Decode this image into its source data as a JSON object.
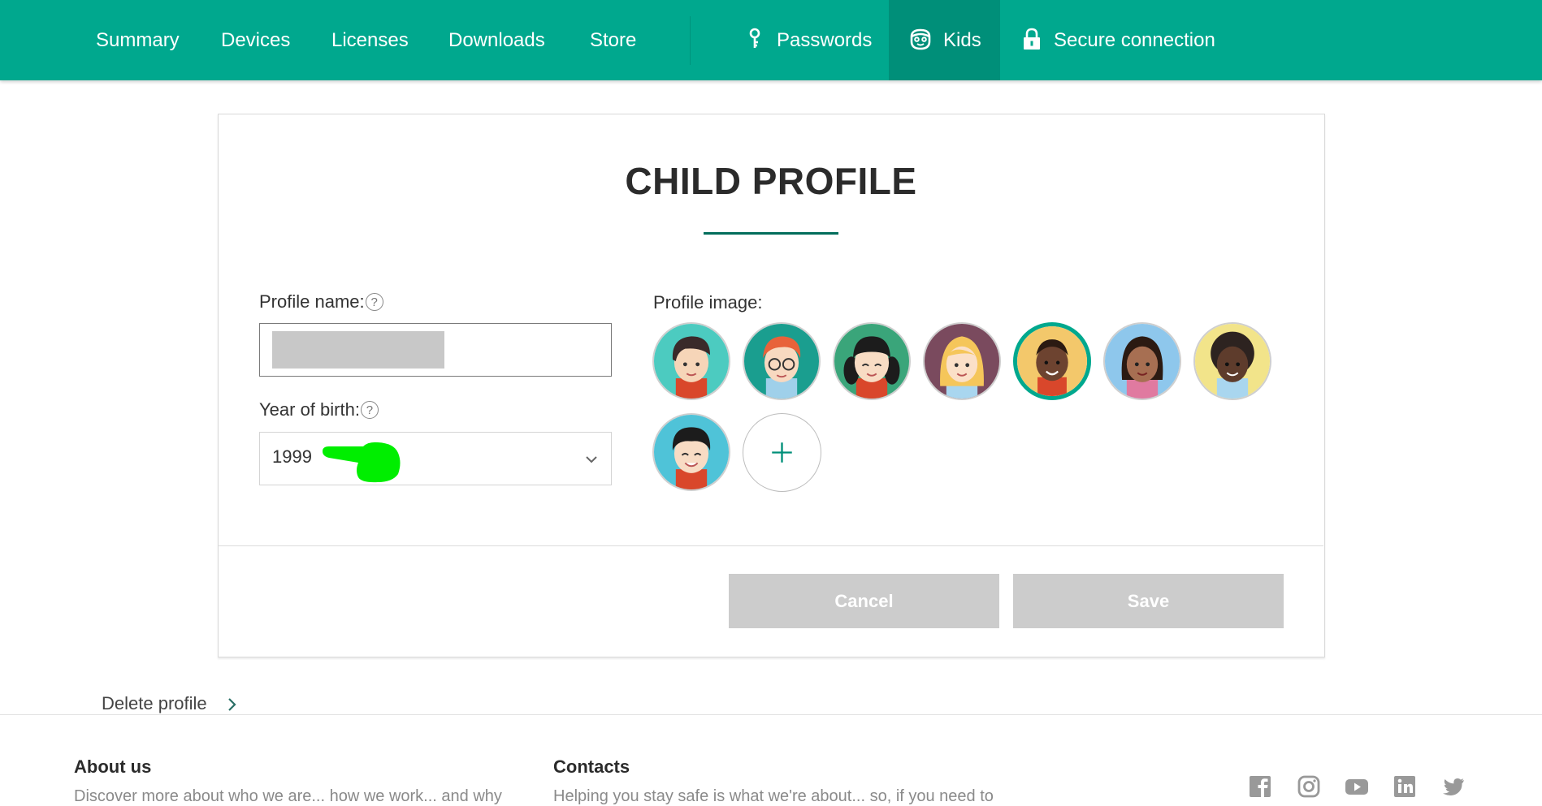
{
  "nav": {
    "items": [
      {
        "label": "Summary"
      },
      {
        "label": "Devices"
      },
      {
        "label": "Licenses"
      },
      {
        "label": "Downloads"
      },
      {
        "label": "Store"
      },
      {
        "label": "Passwords",
        "icon": "key-icon"
      },
      {
        "label": "Kids",
        "icon": "kid-face-icon",
        "active": true
      },
      {
        "label": "Secure connection",
        "icon": "lock-icon"
      }
    ]
  },
  "colors": {
    "brand": "#00a88e",
    "brand_active": "#008f79",
    "title_underline": "#006d5b",
    "button_disabled": "#cccccc"
  },
  "profile": {
    "title": "CHILD PROFILE",
    "name_label": "Profile name:",
    "name_value": "",
    "year_label": "Year of birth:",
    "year_value": "1999",
    "image_label": "Profile image:",
    "help_glyph": "?",
    "avatars": [
      {
        "name": "avatar-boy-dark-hair",
        "selected": false
      },
      {
        "name": "avatar-boy-glasses",
        "selected": false
      },
      {
        "name": "avatar-girl-pigtails",
        "selected": false
      },
      {
        "name": "avatar-girl-blonde",
        "selected": false
      },
      {
        "name": "avatar-boy-dark-skin",
        "selected": true
      },
      {
        "name": "avatar-girl-brown-hair",
        "selected": false
      },
      {
        "name": "avatar-girl-curly-hair",
        "selected": false
      },
      {
        "name": "avatar-boy-black-hair",
        "selected": false
      }
    ],
    "add_image_glyph": "+"
  },
  "actions": {
    "cancel": "Cancel",
    "save": "Save"
  },
  "delete_profile": "Delete profile",
  "footer": {
    "about_heading": "About us",
    "about_text": "Discover more about who we are... how we work... and why",
    "contacts_heading": "Contacts",
    "contacts_text": "Helping you stay safe is what we're about... so, if you need to",
    "social": [
      "facebook-icon",
      "instagram-icon",
      "youtube-icon",
      "linkedin-icon",
      "twitter-icon"
    ]
  }
}
